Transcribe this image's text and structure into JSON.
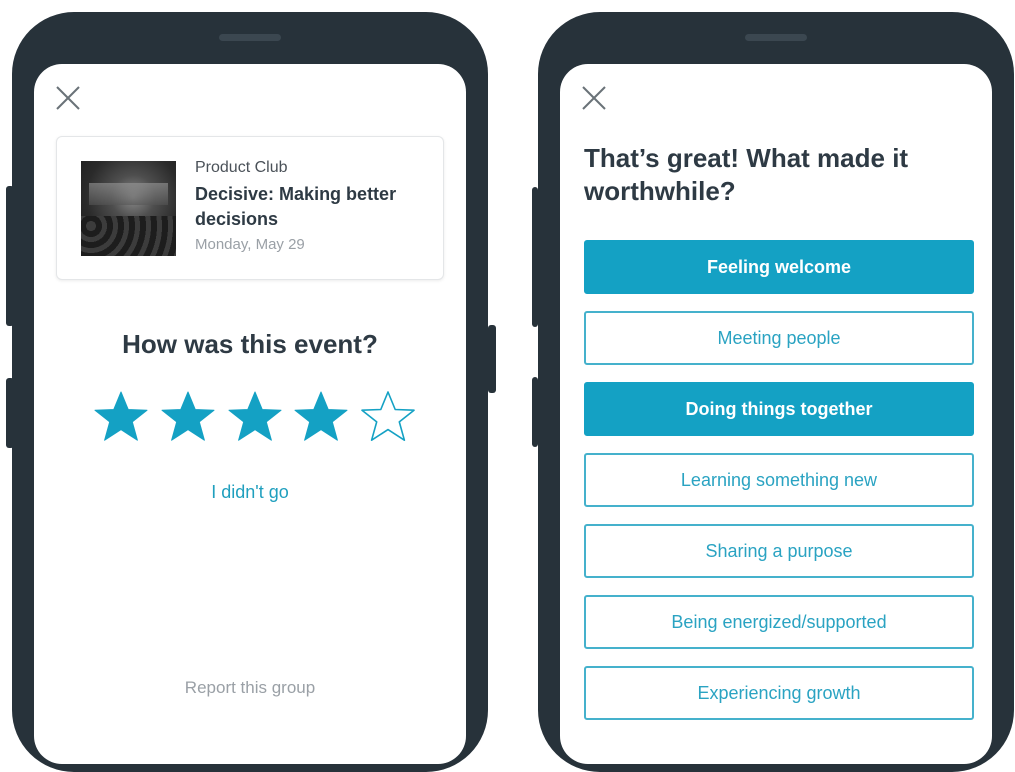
{
  "colors": {
    "accent": "#14a1c4",
    "accent_text": "#2aa3c2",
    "phone_frame": "#27323a",
    "heading": "#2e3a44",
    "muted": "#9aa0a6"
  },
  "left_screen": {
    "close_icon": "close-icon",
    "event": {
      "group_name": "Product Club",
      "title": "Decisive: Making better decisions",
      "date": "Monday, May 29"
    },
    "rating": {
      "heading": "How was this event?",
      "value": 4,
      "max": 5
    },
    "didnt_go_label": "I didn't go",
    "report_label": "Report this group"
  },
  "right_screen": {
    "close_icon": "close-icon",
    "heading": "That’s great! What made it worthwhile?",
    "options": [
      {
        "label": "Feeling welcome",
        "selected": true
      },
      {
        "label": "Meeting people",
        "selected": false
      },
      {
        "label": "Doing things together",
        "selected": true
      },
      {
        "label": "Learning something new",
        "selected": false
      },
      {
        "label": "Sharing a purpose",
        "selected": false
      },
      {
        "label": "Being energized/supported",
        "selected": false
      },
      {
        "label": "Experiencing growth",
        "selected": false
      }
    ]
  }
}
